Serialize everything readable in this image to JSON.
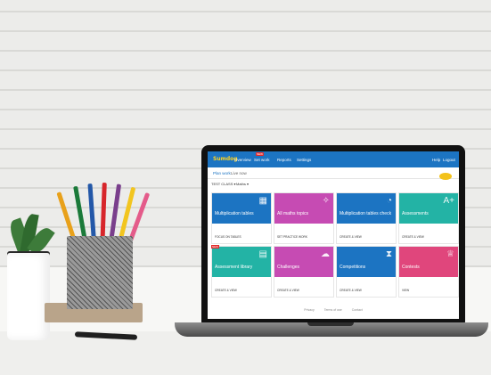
{
  "app": {
    "logo": "Sumdog",
    "nav": {
      "items": [
        "Overview",
        "Set work",
        "Reports",
        "Settings"
      ],
      "new_badge": "NEW",
      "right": [
        "Help",
        "Logout"
      ]
    },
    "subnav": {
      "tabs": [
        "Plan work",
        "Live now"
      ]
    },
    "filters": {
      "class": "TEST CLASS ▾",
      "subject": "Maths ▾"
    },
    "cards": [
      {
        "title": "Multiplication tables",
        "action": "FOCUS ON TABLES",
        "color": "#1c74c2",
        "icon": "grid-icon"
      },
      {
        "title": "All maths topics",
        "action": "SET PRACTICE WORK",
        "color": "#c64bb3",
        "icon": "sparkle-icon"
      },
      {
        "title": "Multiplication tables check",
        "action": "CREATE & VIEW",
        "color": "#1c74c2",
        "icon": "timer-icon"
      },
      {
        "title": "Assessments",
        "action": "CREATE & VIEW",
        "color": "#23b3a5",
        "icon": "a-plus-icon"
      },
      {
        "title": "Assessment library",
        "action": "CREATE & VIEW",
        "color": "#23b3a5",
        "icon": "library-icon",
        "badge": "NEW"
      },
      {
        "title": "Challenges",
        "action": "CREATE & VIEW",
        "color": "#c64bb3",
        "icon": "brain-icon"
      },
      {
        "title": "Competitions",
        "action": "CREATE & VIEW",
        "color": "#1c74c2",
        "icon": "hourglass-icon"
      },
      {
        "title": "Contests",
        "action": "VIEW",
        "color": "#e0467c",
        "icon": "trophy-icon"
      }
    ],
    "footer": [
      "Privacy",
      "Terms of use",
      "Contact"
    ]
  }
}
